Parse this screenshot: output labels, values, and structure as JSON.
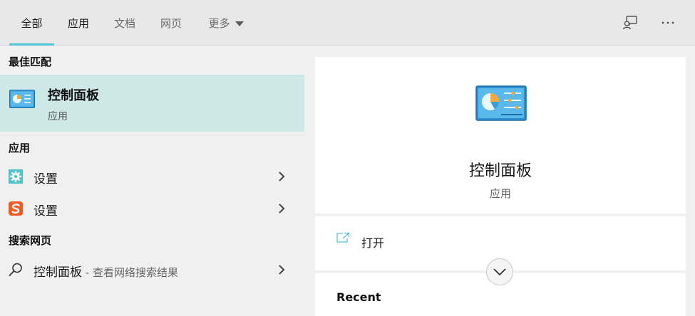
{
  "tabs": [
    {
      "label": "全部",
      "active": true
    },
    {
      "label": "应用",
      "active": false
    },
    {
      "label": "文档",
      "active": false
    },
    {
      "label": "网页",
      "active": false
    },
    {
      "label": "更多",
      "active": false
    }
  ],
  "top_icons": [
    "feedback-icon",
    "more-options-icon"
  ],
  "left": {
    "best_match_header": "最佳匹配",
    "best_match": {
      "title": "控制面板",
      "subtitle": "应用",
      "icon": "control-panel-icon"
    },
    "apps_header": "应用",
    "apps": [
      {
        "label": "设置",
        "icon": "settings-gear-icon"
      },
      {
        "label": "设置",
        "icon": "sogou-icon"
      }
    ],
    "web_header": "搜索网页",
    "web_result": {
      "label": "控制面板",
      "hint": " - 查看网络搜索结果",
      "icon": "search-icon"
    }
  },
  "right": {
    "app_name": "控制面板",
    "app_type": "应用",
    "open_label": "打开",
    "recent_label": "Recent"
  },
  "colors": {
    "accent": "#4fc3d8",
    "selected_bg": "#cde8e6",
    "panel_bg": "#f0f0f0"
  }
}
